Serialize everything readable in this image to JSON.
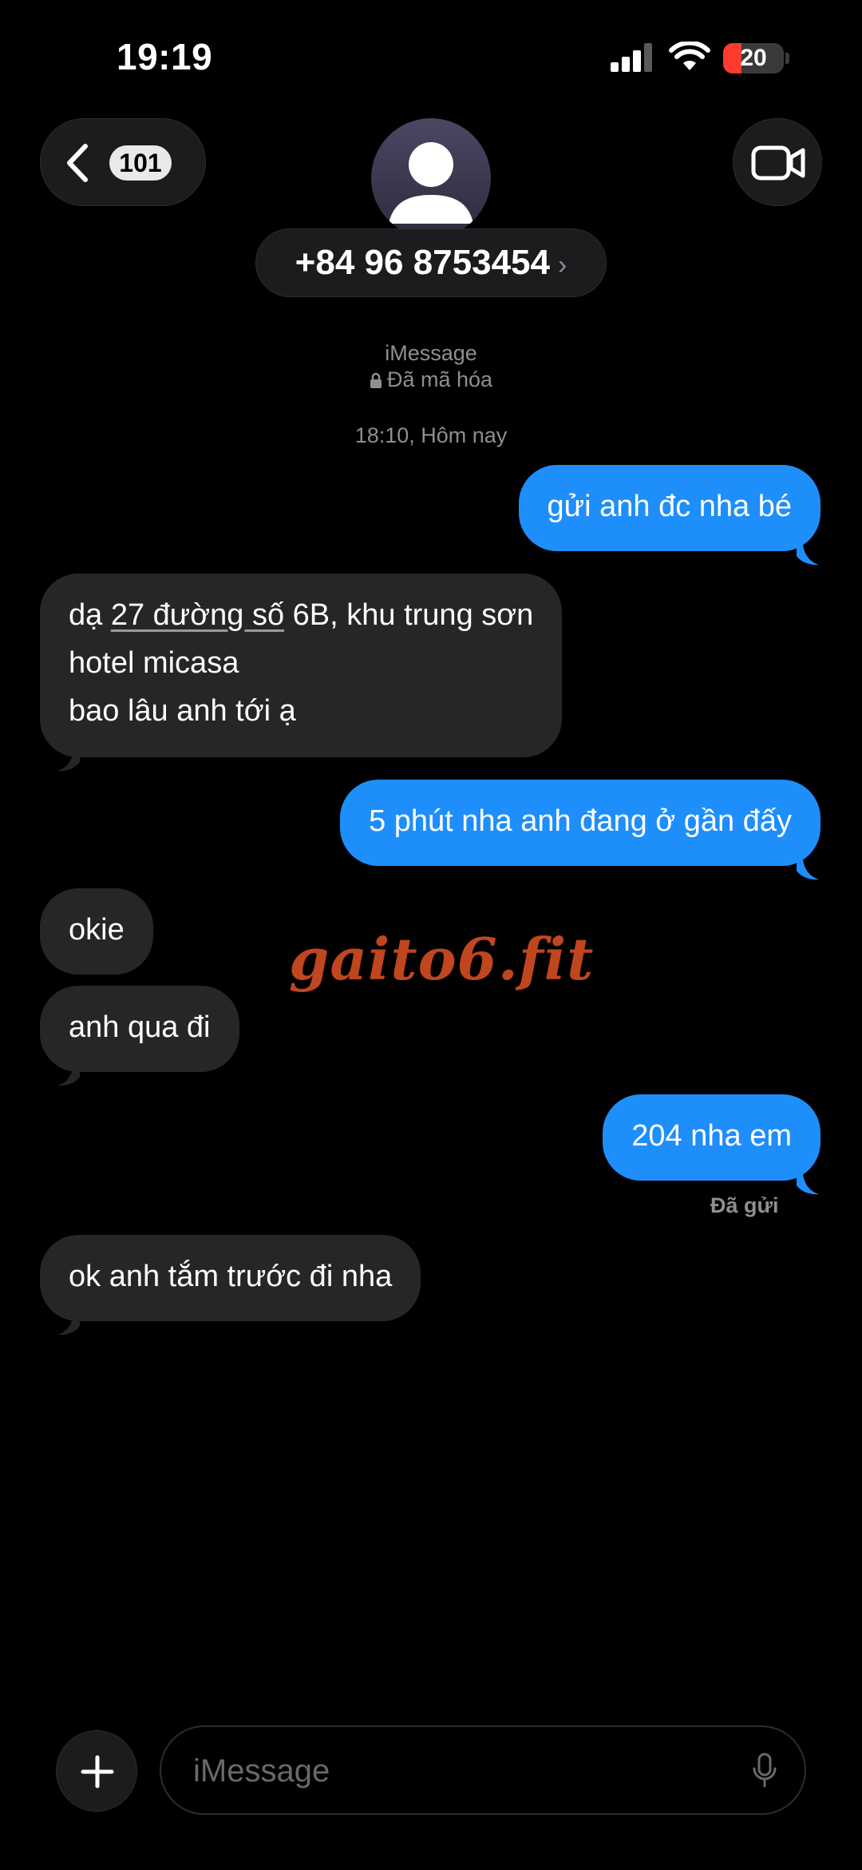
{
  "status_bar": {
    "time": "19:19",
    "battery_level": "20"
  },
  "header": {
    "back_badge": "101",
    "contact_name": "+84 96 8753454",
    "contact_chevron": "›"
  },
  "meta": {
    "service": "iMessage",
    "encryption": "Đã mã hóa",
    "timestamp": "18:10, Hôm nay"
  },
  "messages": [
    {
      "direction": "outgoing",
      "lines": [
        "gửi anh đc nha bé"
      ]
    },
    {
      "direction": "incoming",
      "line1_prefix": "dạ ",
      "line1_link": "27 đường số",
      "line1_suffix": " 6B, khu trung sơn",
      "line2": "hotel micasa",
      "line3": "bao lâu anh tới ạ"
    },
    {
      "direction": "outgoing",
      "lines": [
        "5 phút nha anh đang ở gần đấy"
      ]
    },
    {
      "direction": "incoming",
      "lines": [
        "okie"
      ]
    },
    {
      "direction": "incoming",
      "lines": [
        "anh qua đi"
      ]
    },
    {
      "direction": "outgoing",
      "lines": [
        "204 nha em"
      ]
    },
    {
      "direction": "incoming",
      "lines": [
        "ok anh tắm trước đi nha"
      ]
    }
  ],
  "delivery_status": "Đã gửi",
  "watermark": "gaito6.fit",
  "composer": {
    "placeholder": "iMessage"
  },
  "colors": {
    "outgoing_bubble": "#1e8efa",
    "incoming_bubble": "#262629",
    "watermark": "#c0461f"
  },
  "icons": [
    "signal-icon",
    "wifi-icon",
    "battery-icon",
    "chevron-left-icon",
    "person-icon",
    "video-camera-icon",
    "lock-icon",
    "plus-icon",
    "microphone-icon"
  ]
}
